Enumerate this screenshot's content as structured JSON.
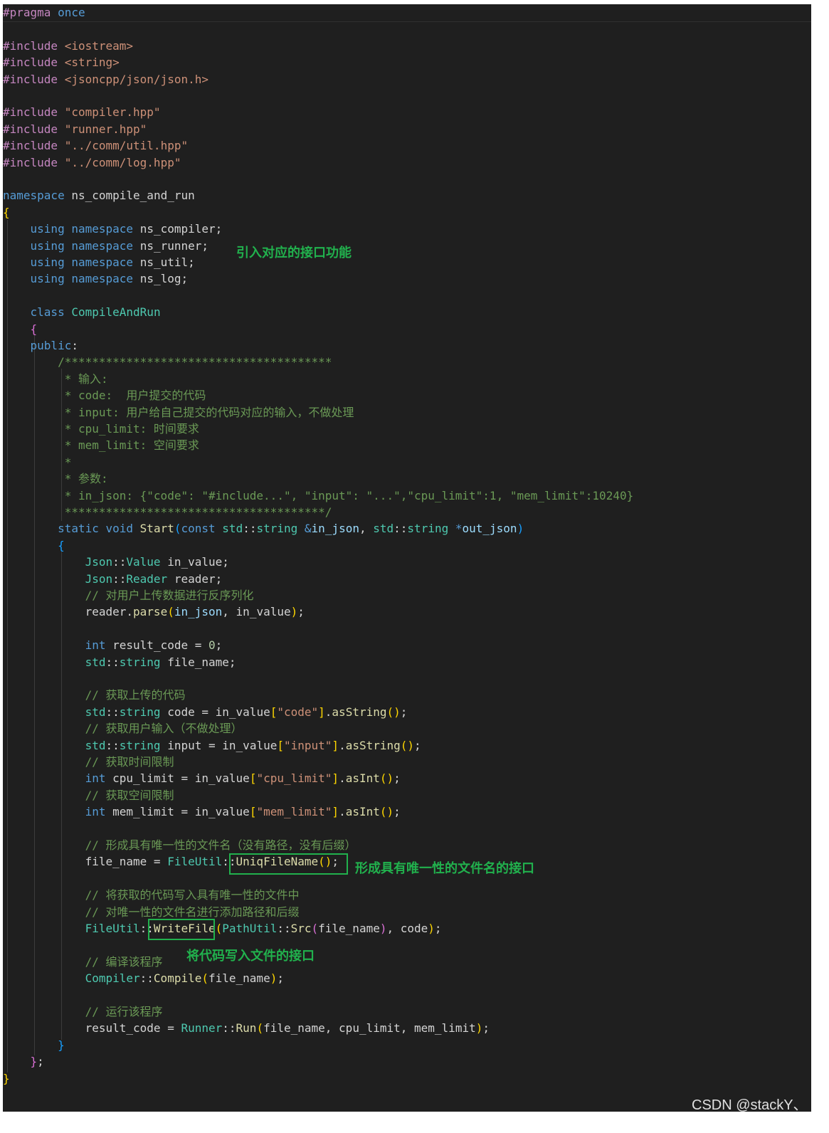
{
  "editor": {
    "theme_background": "#1f1f1f",
    "language": "C++",
    "lines": [
      [
        [
          "#pragma",
          "pp"
        ],
        [
          " "
        ],
        [
          "once",
          "kw"
        ]
      ],
      [],
      [
        [
          "#include",
          "pp"
        ],
        [
          " "
        ],
        [
          "<iostream>",
          "str"
        ]
      ],
      [
        [
          "#include",
          "pp"
        ],
        [
          " "
        ],
        [
          "<string>",
          "str"
        ]
      ],
      [
        [
          "#include",
          "pp"
        ],
        [
          " "
        ],
        [
          "<jsoncpp/json/json.h>",
          "str"
        ]
      ],
      [],
      [
        [
          "#include",
          "pp"
        ],
        [
          " "
        ],
        [
          "\"compiler.hpp\"",
          "str"
        ]
      ],
      [
        [
          "#include",
          "pp"
        ],
        [
          " "
        ],
        [
          "\"runner.hpp\"",
          "str"
        ]
      ],
      [
        [
          "#include",
          "pp"
        ],
        [
          " "
        ],
        [
          "\"../comm/util.hpp\"",
          "str"
        ]
      ],
      [
        [
          "#include",
          "pp"
        ],
        [
          " "
        ],
        [
          "\"../comm/log.hpp\"",
          "str"
        ]
      ],
      [],
      [
        [
          "namespace",
          "kw"
        ],
        [
          " "
        ],
        [
          "ns_compile_and_run",
          "id"
        ]
      ],
      [
        [
          "{",
          "brY"
        ]
      ],
      [
        [
          "    "
        ],
        [
          "using",
          "kw"
        ],
        [
          " "
        ],
        [
          "namespace",
          "kw"
        ],
        [
          " "
        ],
        [
          "ns_compiler",
          "id"
        ],
        [
          ";"
        ]
      ],
      [
        [
          "    "
        ],
        [
          "using",
          "kw"
        ],
        [
          " "
        ],
        [
          "namespace",
          "kw"
        ],
        [
          " "
        ],
        [
          "ns_runner",
          "id"
        ],
        [
          ";"
        ]
      ],
      [
        [
          "    "
        ],
        [
          "using",
          "kw"
        ],
        [
          " "
        ],
        [
          "namespace",
          "kw"
        ],
        [
          " "
        ],
        [
          "ns_util",
          "id"
        ],
        [
          ";"
        ]
      ],
      [
        [
          "    "
        ],
        [
          "using",
          "kw"
        ],
        [
          " "
        ],
        [
          "namespace",
          "kw"
        ],
        [
          " "
        ],
        [
          "ns_log",
          "id"
        ],
        [
          ";"
        ]
      ],
      [],
      [
        [
          "    "
        ],
        [
          "class",
          "kw"
        ],
        [
          " "
        ],
        [
          "CompileAndRun",
          "ty"
        ]
      ],
      [
        [
          "    "
        ],
        [
          "{",
          "brP"
        ]
      ],
      [
        [
          "    "
        ],
        [
          "public",
          "kw"
        ],
        [
          ":"
        ]
      ],
      [
        [
          "        "
        ],
        [
          "/***************************************",
          "cm"
        ]
      ],
      [
        [
          "        "
        ],
        [
          " * 输入:",
          "cm"
        ]
      ],
      [
        [
          "        "
        ],
        [
          " * code:  用户提交的代码",
          "cm"
        ]
      ],
      [
        [
          "        "
        ],
        [
          " * input: 用户给自己提交的代码对应的输入，不做处理",
          "cm"
        ]
      ],
      [
        [
          "        "
        ],
        [
          " * cpu_limit: 时间要求",
          "cm"
        ]
      ],
      [
        [
          "        "
        ],
        [
          " * mem_limit: 空间要求",
          "cm"
        ]
      ],
      [
        [
          "        "
        ],
        [
          " *",
          "cm"
        ]
      ],
      [
        [
          "        "
        ],
        [
          " * 参数:",
          "cm"
        ]
      ],
      [
        [
          "        "
        ],
        [
          " * in_json: {\"code\": \"#include...\", \"input\": \"...\",\"cpu_limit\":1, \"mem_limit\":10240}",
          "cm"
        ]
      ],
      [
        [
          "        "
        ],
        [
          " **************************************/",
          "cm"
        ]
      ],
      [
        [
          "        "
        ],
        [
          "static",
          "kw"
        ],
        [
          " "
        ],
        [
          "void",
          "kw"
        ],
        [
          " "
        ],
        [
          "Start",
          "fn"
        ],
        [
          "(",
          "brB"
        ],
        [
          "const",
          "kw"
        ],
        [
          " "
        ],
        [
          "std",
          "ns"
        ],
        [
          "::"
        ],
        [
          "string",
          "ty"
        ],
        [
          " "
        ],
        [
          "&",
          "kw"
        ],
        [
          "in_json",
          "par"
        ],
        [
          ", "
        ],
        [
          "std",
          "ns"
        ],
        [
          "::"
        ],
        [
          "string",
          "ty"
        ],
        [
          " "
        ],
        [
          "*",
          "kw"
        ],
        [
          "out_json",
          "par"
        ],
        [
          ")",
          "brB"
        ]
      ],
      [
        [
          "        "
        ],
        [
          "{",
          "brB"
        ]
      ],
      [
        [
          "            "
        ],
        [
          "Json",
          "ns"
        ],
        [
          "::"
        ],
        [
          "Value",
          "ty"
        ],
        [
          " "
        ],
        [
          "in_value",
          "id"
        ],
        [
          ";"
        ]
      ],
      [
        [
          "            "
        ],
        [
          "Json",
          "ns"
        ],
        [
          "::"
        ],
        [
          "Reader",
          "ty"
        ],
        [
          " "
        ],
        [
          "reader",
          "id"
        ],
        [
          ";"
        ]
      ],
      [
        [
          "            "
        ],
        [
          "// 对用户上传数据进行反序列化",
          "cm"
        ]
      ],
      [
        [
          "            "
        ],
        [
          "reader",
          "id"
        ],
        [
          "."
        ],
        [
          "parse",
          "fn"
        ],
        [
          "(",
          "brY"
        ],
        [
          "in_json",
          "par"
        ],
        [
          ", "
        ],
        [
          "in_value",
          "id"
        ],
        [
          ")",
          "brY"
        ],
        [
          ";"
        ]
      ],
      [],
      [
        [
          "            "
        ],
        [
          "int",
          "kw"
        ],
        [
          " "
        ],
        [
          "result_code",
          "id"
        ],
        [
          " = "
        ],
        [
          "0",
          "num"
        ],
        [
          ";"
        ]
      ],
      [
        [
          "            "
        ],
        [
          "std",
          "ns"
        ],
        [
          "::"
        ],
        [
          "string",
          "ty"
        ],
        [
          " "
        ],
        [
          "file_name",
          "id"
        ],
        [
          ";"
        ]
      ],
      [],
      [
        [
          "            "
        ],
        [
          "// 获取上传的代码",
          "cm"
        ]
      ],
      [
        [
          "            "
        ],
        [
          "std",
          "ns"
        ],
        [
          "::"
        ],
        [
          "string",
          "ty"
        ],
        [
          " "
        ],
        [
          "code",
          "id"
        ],
        [
          " = "
        ],
        [
          "in_value",
          "id"
        ],
        [
          "[",
          "brY"
        ],
        [
          "\"code\"",
          "str"
        ],
        [
          "]",
          "brY"
        ],
        [
          "."
        ],
        [
          "asString",
          "fn"
        ],
        [
          "()",
          "brY"
        ],
        [
          ";"
        ]
      ],
      [
        [
          "            "
        ],
        [
          "// 获取用户输入（不做处理）",
          "cm"
        ]
      ],
      [
        [
          "            "
        ],
        [
          "std",
          "ns"
        ],
        [
          "::"
        ],
        [
          "string",
          "ty"
        ],
        [
          " "
        ],
        [
          "input",
          "id"
        ],
        [
          " = "
        ],
        [
          "in_value",
          "id"
        ],
        [
          "[",
          "brY"
        ],
        [
          "\"input\"",
          "str"
        ],
        [
          "]",
          "brY"
        ],
        [
          "."
        ],
        [
          "asString",
          "fn"
        ],
        [
          "()",
          "brY"
        ],
        [
          ";"
        ]
      ],
      [
        [
          "            "
        ],
        [
          "// 获取时间限制",
          "cm"
        ]
      ],
      [
        [
          "            "
        ],
        [
          "int",
          "kw"
        ],
        [
          " "
        ],
        [
          "cpu_limit",
          "id"
        ],
        [
          " = "
        ],
        [
          "in_value",
          "id"
        ],
        [
          "[",
          "brY"
        ],
        [
          "\"cpu_limit\"",
          "str"
        ],
        [
          "]",
          "brY"
        ],
        [
          "."
        ],
        [
          "asInt",
          "fn"
        ],
        [
          "()",
          "brY"
        ],
        [
          ";"
        ]
      ],
      [
        [
          "            "
        ],
        [
          "// 获取空间限制",
          "cm"
        ]
      ],
      [
        [
          "            "
        ],
        [
          "int",
          "kw"
        ],
        [
          " "
        ],
        [
          "mem_limit",
          "id"
        ],
        [
          " = "
        ],
        [
          "in_value",
          "id"
        ],
        [
          "[",
          "brY"
        ],
        [
          "\"mem_limit\"",
          "str"
        ],
        [
          "]",
          "brY"
        ],
        [
          "."
        ],
        [
          "asInt",
          "fn"
        ],
        [
          "()",
          "brY"
        ],
        [
          ";"
        ]
      ],
      [],
      [
        [
          "            "
        ],
        [
          "// 形成具有唯一性的文件名（没有路径，没有后缀）",
          "cm"
        ]
      ],
      [
        [
          "            "
        ],
        [
          "file_name",
          "id"
        ],
        [
          " = "
        ],
        [
          "FileUtil",
          "ns"
        ],
        [
          "::"
        ],
        [
          "UniqFileName",
          "fn"
        ],
        [
          "()",
          "brY"
        ],
        [
          ";"
        ]
      ],
      [],
      [
        [
          "            "
        ],
        [
          "// 将获取的代码写入具有唯一性的文件中",
          "cm"
        ]
      ],
      [
        [
          "            "
        ],
        [
          "// 对唯一性的文件名进行添加路径和后缀",
          "cm"
        ]
      ],
      [
        [
          "            "
        ],
        [
          "FileUtil",
          "ns"
        ],
        [
          "::"
        ],
        [
          "WriteFile",
          "fn"
        ],
        [
          "(",
          "brY"
        ],
        [
          "PathUtil",
          "ns"
        ],
        [
          "::"
        ],
        [
          "Src",
          "fn"
        ],
        [
          "(",
          "brP"
        ],
        [
          "file_name",
          "id"
        ],
        [
          ")",
          "brP"
        ],
        [
          ", "
        ],
        [
          "code",
          "id"
        ],
        [
          ")",
          "brY"
        ],
        [
          ";"
        ]
      ],
      [],
      [
        [
          "            "
        ],
        [
          "// 编译该程序",
          "cm"
        ]
      ],
      [
        [
          "            "
        ],
        [
          "Compiler",
          "ns"
        ],
        [
          "::"
        ],
        [
          "Compile",
          "fn"
        ],
        [
          "(",
          "brY"
        ],
        [
          "file_name",
          "id"
        ],
        [
          ")",
          "brY"
        ],
        [
          ";"
        ]
      ],
      [],
      [
        [
          "            "
        ],
        [
          "// 运行该程序",
          "cm"
        ]
      ],
      [
        [
          "            "
        ],
        [
          "result_code",
          "id"
        ],
        [
          " = "
        ],
        [
          "Runner",
          "ns"
        ],
        [
          "::"
        ],
        [
          "Run",
          "fn"
        ],
        [
          "(",
          "brY"
        ],
        [
          "file_name",
          "id"
        ],
        [
          ", "
        ],
        [
          "cpu_limit",
          "id"
        ],
        [
          ", "
        ],
        [
          "mem_limit",
          "id"
        ],
        [
          ")",
          "brY"
        ],
        [
          ";"
        ]
      ],
      [
        [
          "        "
        ],
        [
          "}",
          "brB"
        ]
      ],
      [
        [
          "    "
        ],
        [
          "}",
          "brP"
        ],
        [
          ";"
        ]
      ],
      [
        [
          "}",
          "brY"
        ]
      ]
    ]
  },
  "annotations": {
    "interface_import": "引入对应的接口功能",
    "uniq_filename": "形成具有唯一性的文件名的接口",
    "write_file": "将代码写入文件的接口"
  },
  "highlight_color": "#21b14d",
  "watermark": "CSDN @stackY、"
}
